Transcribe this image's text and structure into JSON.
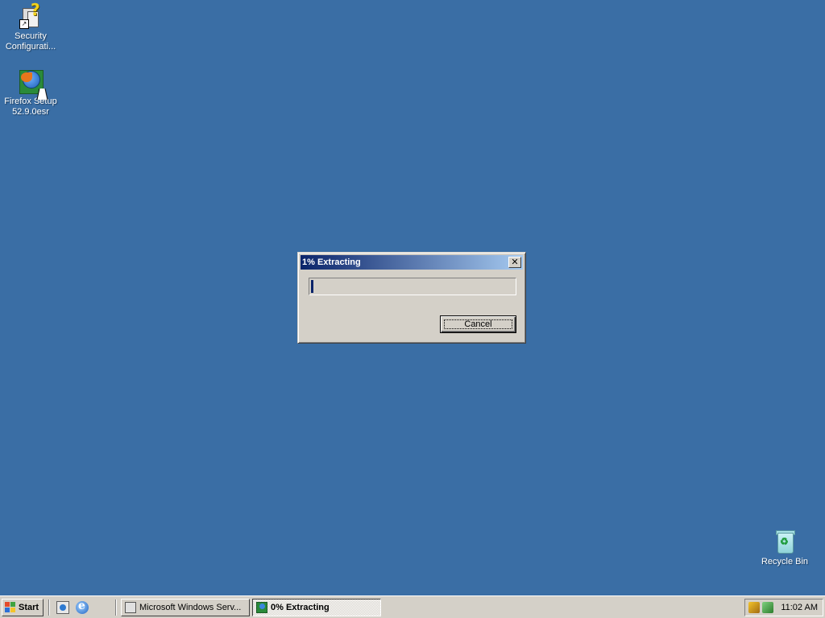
{
  "desktop": {
    "background_color": "#3a6ea5",
    "icons": [
      {
        "name": "security-config-wizard",
        "label": "Security Configurati...",
        "icon": "security-config-icon"
      },
      {
        "name": "firefox-setup",
        "label_line1": "Firefox Setup",
        "label_line2": "52.9.0esr",
        "icon": "firefox-installer-icon"
      },
      {
        "name": "recycle-bin",
        "label": "Recycle Bin",
        "icon": "recycle-bin-icon"
      }
    ]
  },
  "dialog": {
    "title": "1% Extracting",
    "close_glyph": "✕",
    "progress_fraction": 0.01,
    "cancel_label": "Cancel"
  },
  "taskbar": {
    "start_label": "Start",
    "quick_launch": [
      "internet-explorer-icon",
      "show-desktop-icon"
    ],
    "tasks": [
      {
        "label": "Microsoft Windows Serv...",
        "active": false,
        "icon": "security-config-icon"
      },
      {
        "label": "0% Extracting",
        "active": true,
        "icon": "firefox-installer-icon"
      }
    ],
    "tray_icons": [
      "update-icon",
      "network-icon"
    ],
    "clock": "11:02 AM"
  }
}
